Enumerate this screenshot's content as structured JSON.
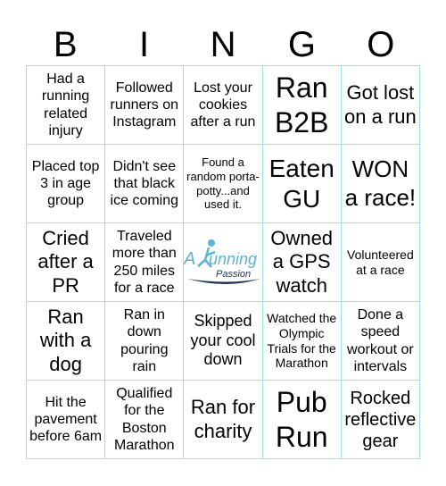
{
  "header": [
    "B",
    "I",
    "N",
    "G",
    "O"
  ],
  "cells": [
    "Had a running related injury",
    "Followed runners on Instagram",
    "Lost your cookies after a run",
    "Ran B2B",
    "Got lost on a run",
    "Placed top 3 in age group",
    "Didn't see that black ice coming",
    "Found a random porta-potty...and used it.",
    "Eaten GU",
    "WON a race!",
    "Cried after a PR",
    "Traveled more than 250 miles for a race",
    "",
    "Owned a GPS watch",
    "Volunteered at a race",
    "Ran with a dog",
    "Ran in down pouring rain",
    "Skipped your cool down",
    "Watched the Olympic Trials for the Marathon",
    "Done a speed workout or intervals",
    "Hit the pavement before 6am",
    "Qualified for the Boston Marathon",
    "Ran for charity",
    "Pub Run",
    "Rocked reflective gear"
  ],
  "free_space": {
    "logo_text": "A Running Passion",
    "icon": "runner-logo"
  },
  "colors": {
    "grid": "#9fdfea",
    "logo_primary": "#5ab4d6",
    "logo_dark": "#1d3557"
  }
}
